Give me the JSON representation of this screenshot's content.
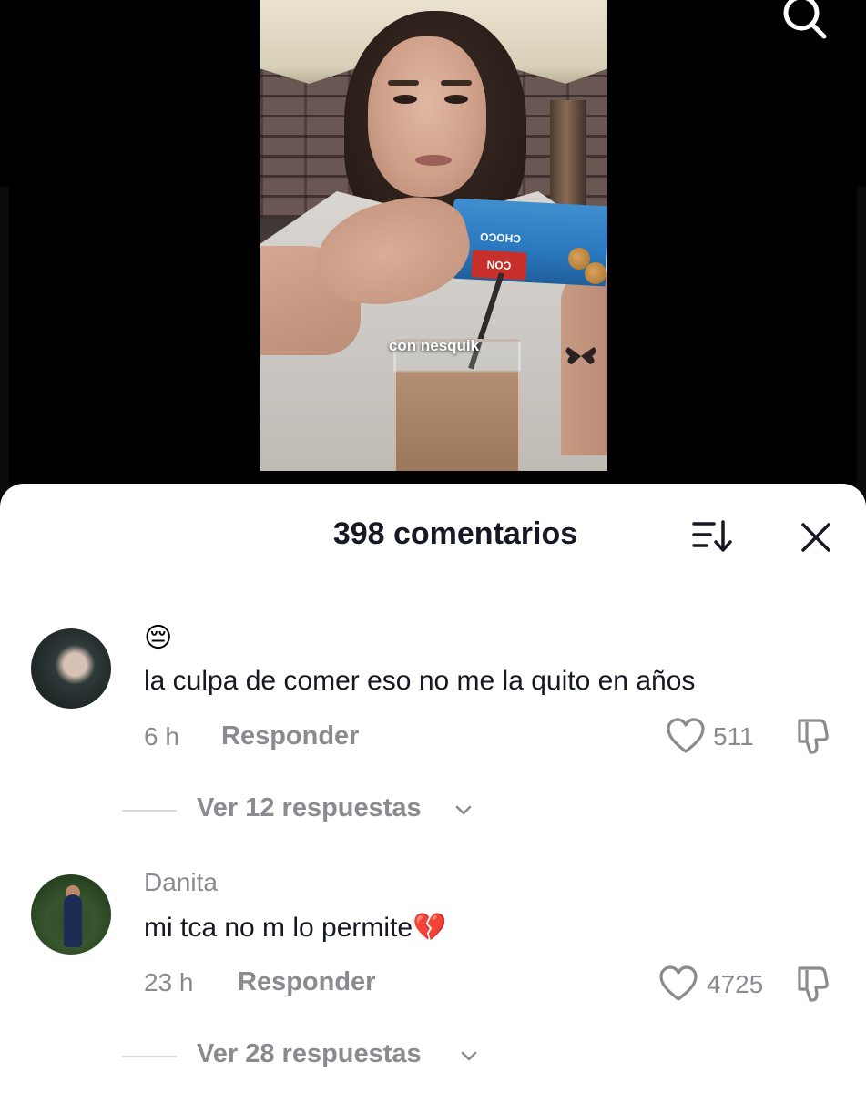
{
  "video": {
    "caption": "con nesquik",
    "pack_label": "CON CHOCO"
  },
  "search": {
    "icon": "search-icon"
  },
  "comments_sheet": {
    "title": "398 comentarios",
    "sort_icon": "sort-icon",
    "close_icon": "close-icon"
  },
  "comments": [
    {
      "username": "",
      "emoji": "😔",
      "text": "la culpa de comer eso no me la quito en años",
      "time": "6 h",
      "reply_label": "Responder",
      "likes": "511",
      "view_replies": "Ver 12 respuestas"
    },
    {
      "username": "Danita",
      "text": "mi tca no m lo permite💔",
      "time": "23 h",
      "reply_label": "Responder",
      "likes": "4725",
      "view_replies": "Ver 28 respuestas"
    }
  ],
  "colors": {
    "background": "#000000",
    "sheet": "#ffffff",
    "primary_text": "#161823",
    "secondary_text": "#8a8b91"
  }
}
